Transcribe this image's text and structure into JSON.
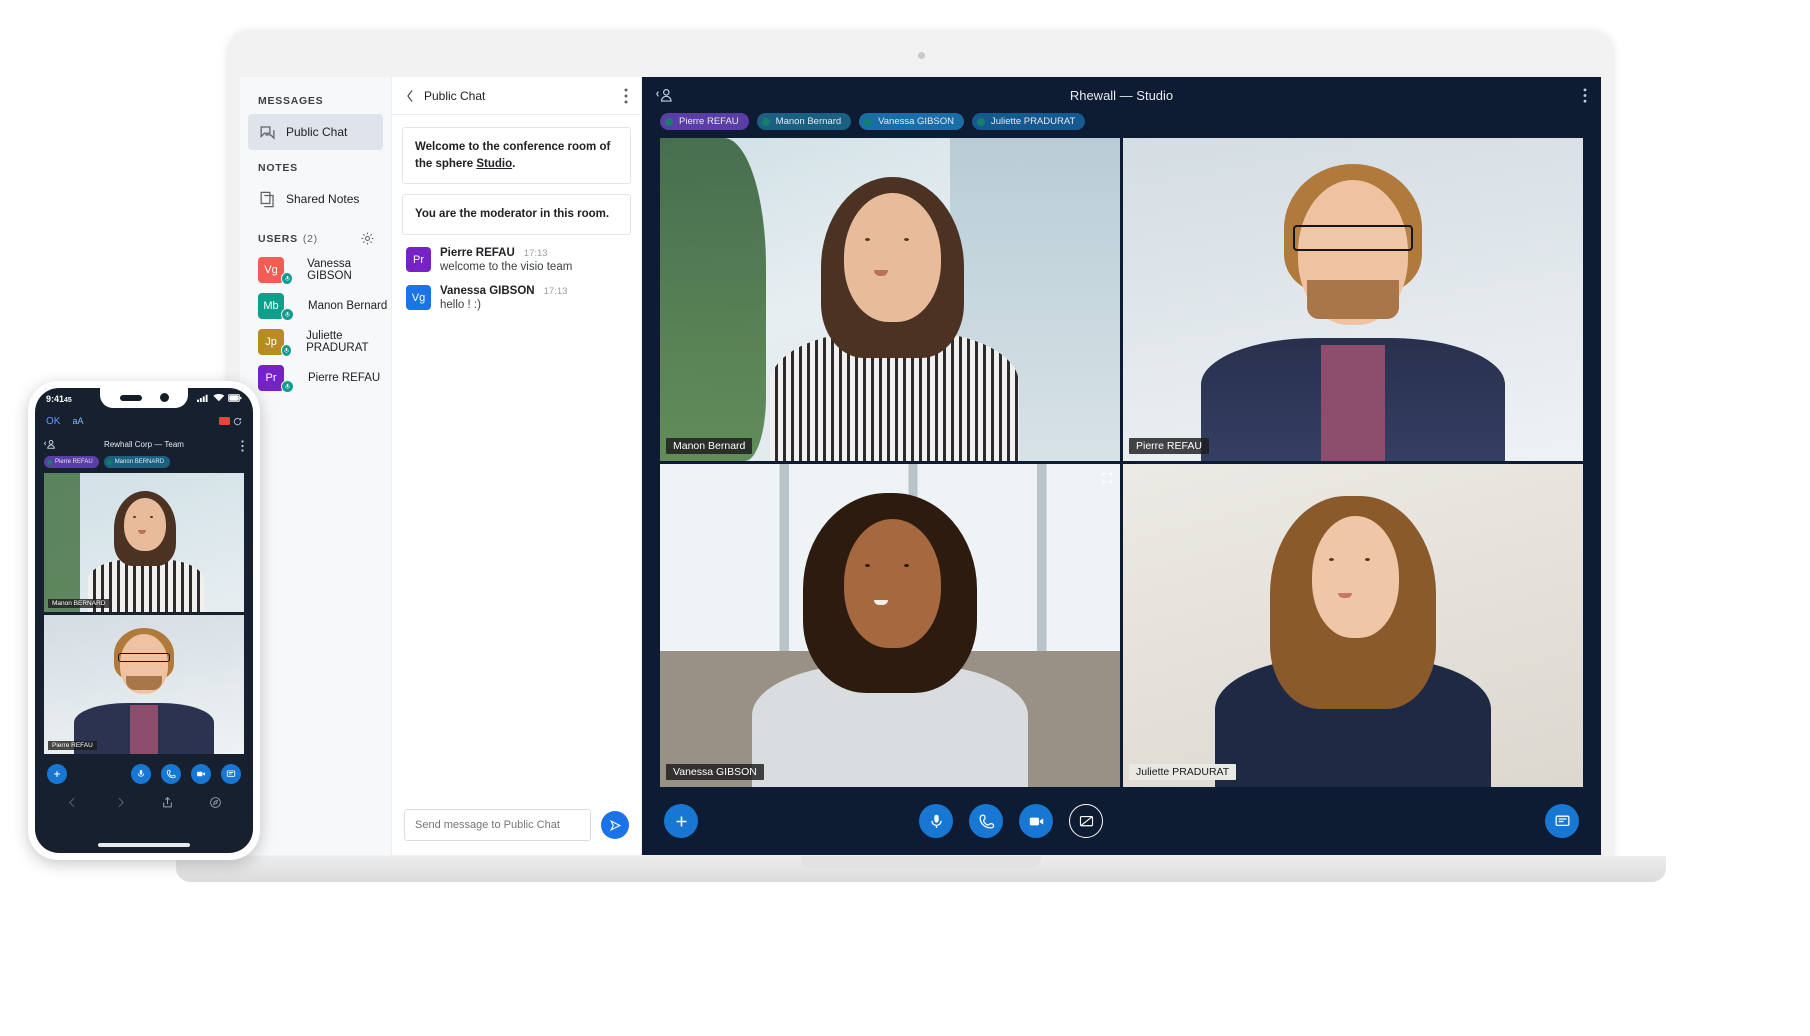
{
  "webapp": {
    "sidebar": {
      "messages_header": "MESSAGES",
      "public_chat_label": "Public Chat",
      "notes_header": "NOTES",
      "shared_notes_label": "Shared Notes",
      "users_header": "USERS",
      "users_count": "(2)",
      "users": [
        {
          "initials": "Vg",
          "name": "Vanessa GIBSON",
          "color": "#ef5d55"
        },
        {
          "initials": "Mb",
          "name": "Manon Bernard",
          "color": "#0fa08c"
        },
        {
          "initials": "Jp",
          "name": "Juliette PRADURAT",
          "color": "#b98b26"
        },
        {
          "initials": "Pr",
          "name": "Pierre REFAU",
          "color": "#7722c7"
        }
      ]
    },
    "chat": {
      "title": "Public Chat",
      "notices": [
        {
          "text": "Welcome to the conference room of the sphere ",
          "link": "Studio",
          "tail": "."
        },
        {
          "text": "You are the moderator in this room.",
          "link": "",
          "tail": ""
        }
      ],
      "messages": [
        {
          "initials": "Pr",
          "color": "#7722c7",
          "name": "Pierre REFAU",
          "time": "17:13",
          "text": "welcome to the visio team"
        },
        {
          "initials": "Vg",
          "color": "#1a73e8",
          "name": "Vanessa GIBSON",
          "time": "17:13",
          "text": "hello ! :)"
        }
      ],
      "input_placeholder": "Send message to Public Chat"
    },
    "video": {
      "room_title": "Rhewall — Studio",
      "chips": [
        {
          "label": "Pierre  REFAU",
          "bg": "#5b3da8"
        },
        {
          "label": "Manon Bernard",
          "bg": "#1b6081"
        },
        {
          "label": "Vanessa GIBSON",
          "bg": "#1a6ea8"
        },
        {
          "label": "Juliette PRADURAT",
          "bg": "#14598f"
        }
      ],
      "tiles": [
        {
          "name": "Manon Bernard",
          "active": false,
          "light_label": false
        },
        {
          "name": "Pierre  REFAU",
          "active": false,
          "light_label": false
        },
        {
          "name": "Vanessa GIBSON",
          "active": true,
          "light_label": false
        },
        {
          "name": "Juliette PRADURAT",
          "active": false,
          "light_label": true
        }
      ],
      "controls": {
        "add_label": "add",
        "mic_label": "microphone",
        "phone_label": "hang-up",
        "camera_label": "camera",
        "screenshare_label": "screen-share",
        "present_label": "presentation"
      }
    }
  },
  "phone": {
    "status": {
      "time": "9:41",
      "time_sec": "45"
    },
    "browser": {
      "done": "OK",
      "textsize": "aA"
    },
    "header": {
      "title": "Rewhall Corp  —  Team"
    },
    "chips": [
      {
        "label": "Pierre  REFAU",
        "bg": "#5b3da8"
      },
      {
        "label": "Manon BERNARD",
        "bg": "#1b6081"
      }
    ],
    "tiles": [
      {
        "name": "Manon BERNARD"
      },
      {
        "name": "Pierre  REFAU"
      }
    ]
  },
  "colors": {
    "accent": "#1877d2",
    "video_bg": "#0d1b33",
    "sidebar_bg": "#f7f8fa",
    "active_tile": "#2d8ee0"
  }
}
